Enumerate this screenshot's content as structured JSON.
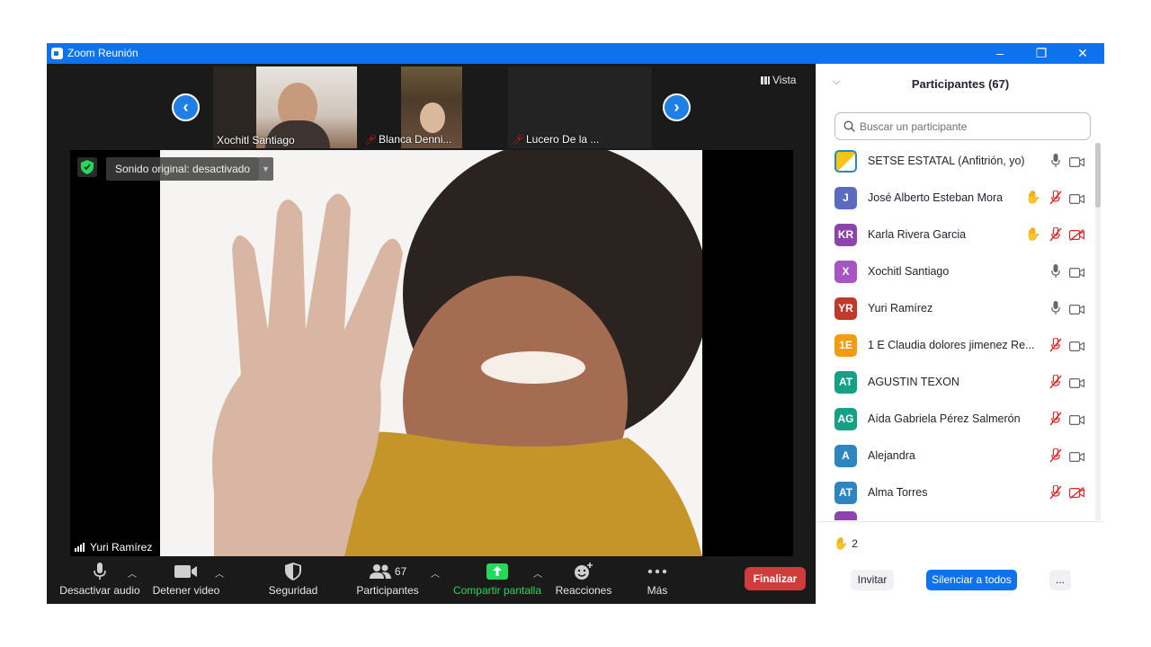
{
  "window": {
    "title": "Zoom Reunión",
    "controls": [
      "–",
      "❐",
      "✕"
    ]
  },
  "stage": {
    "view_label": "Vista",
    "thumbnails": [
      {
        "name": "Xochitl Santiago",
        "muted": false
      },
      {
        "name": "Blanca Denni...",
        "muted": true
      },
      {
        "name": "Lucero De la ...",
        "muted": true
      }
    ],
    "sound_original": "Sonido original: desactivado",
    "active_speaker": "Yuri Ramírez"
  },
  "toolbar": {
    "mute_label": "Desactivar audio",
    "video_label": "Detener video",
    "security_label": "Seguridad",
    "participants_label": "Participantes",
    "participants_count": "67",
    "share_label": "Compartir pantalla",
    "reactions_label": "Reacciones",
    "more_label": "Más",
    "end_label": "Finalizar",
    "share_color": "#23d959",
    "end_color": "#d03b3b"
  },
  "panel": {
    "title": "Participantes (67)",
    "search_placeholder": "Buscar un participante",
    "raised_hands_count": "2",
    "invite_label": "Invitar",
    "mute_all_label": "Silenciar a todos",
    "more_label": "...",
    "participants": [
      {
        "initials": "",
        "name": "SETSE ESTATAL (Anfitrión, yo)",
        "color": "#f5c518",
        "hand": false,
        "mic": "on",
        "cam": "on"
      },
      {
        "initials": "J",
        "name": "José Alberto Esteban Mora",
        "color": "#5b6bc0",
        "hand": true,
        "mic": "muted",
        "cam": "on"
      },
      {
        "initials": "KR",
        "name": "Karla Rivera Garcia",
        "color": "#8e44ad",
        "hand": true,
        "mic": "muted",
        "cam": "off"
      },
      {
        "initials": "X",
        "name": "Xochitl Santiago",
        "color": "#a855c4",
        "hand": false,
        "mic": "on",
        "cam": "on"
      },
      {
        "initials": "YR",
        "name": "Yuri Ramírez",
        "color": "#c0392b",
        "hand": false,
        "mic": "on",
        "cam": "on"
      },
      {
        "initials": "1E",
        "name": "1 E Claudia dolores jimenez Re...",
        "color": "#f39c12",
        "hand": false,
        "mic": "muted",
        "cam": "on"
      },
      {
        "initials": "AT",
        "name": "AGUSTIN TEXON",
        "color": "#16a085",
        "hand": false,
        "mic": "muted",
        "cam": "on"
      },
      {
        "initials": "AG",
        "name": "Aída Gabriela Pérez Salmerón",
        "color": "#16a085",
        "hand": false,
        "mic": "muted",
        "cam": "on"
      },
      {
        "initials": "A",
        "name": "Alejandra",
        "color": "#2e86c1",
        "hand": false,
        "mic": "muted",
        "cam": "on"
      },
      {
        "initials": "AT",
        "name": "Alma Torres",
        "color": "#2e86c1",
        "hand": false,
        "mic": "muted",
        "cam": "off"
      }
    ]
  }
}
